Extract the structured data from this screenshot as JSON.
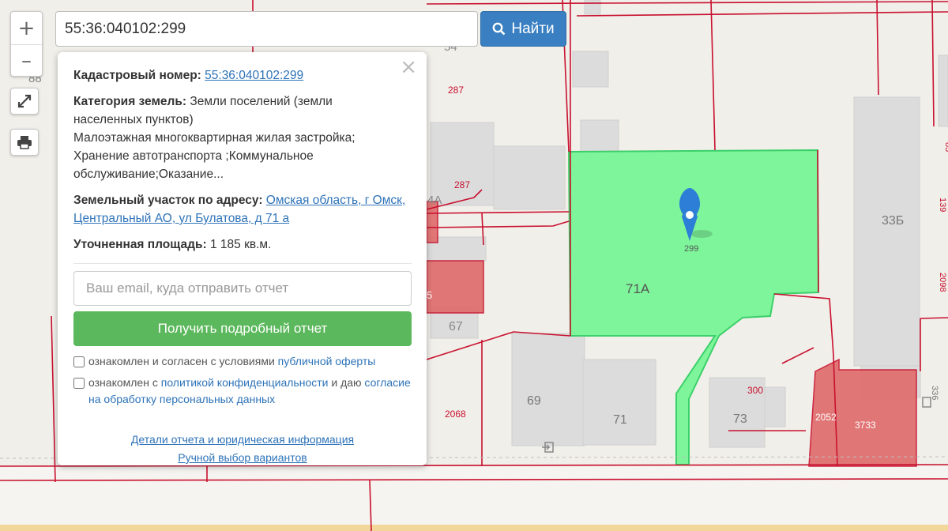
{
  "search": {
    "value": "55:36:040102:299",
    "button_label": "Найти"
  },
  "map_controls": {
    "zoom_in": "+",
    "zoom_out": "–"
  },
  "popup": {
    "close": "×",
    "cadastral_label": "Кадастровый номер:",
    "cadastral_value": "55:36:040102:299",
    "category_label": "Категория земель:",
    "category_value": "Земли поселений (земли населенных пунктов)",
    "usage_lines": [
      "Малоэтажная многоквартирная жилая застройка;",
      "Хранение автотранспорта ;Коммунальное",
      "обслуживание;Оказание..."
    ],
    "address_label": "Земельный участок по адресу:",
    "address_value": "Омская область, г Омск, Центральный АО, ул Булатова, д 71 а",
    "area_label": "Уточненная площадь:",
    "area_value": "1 185 кв.м.",
    "email_placeholder": "Ваш email, куда отправить отчет",
    "report_button": "Получить подробный отчет",
    "consent1_text": "ознакомлен и согласен с условиями",
    "consent1_link": "публичной оферты",
    "consent2_text": "ознакомлен с",
    "consent2_link": "политикой конфиденциальности",
    "consent2_text2": "и даю",
    "consent2_link2": "согласие на обработку персональных данных",
    "details_link": "Детали отчета и юридическая информация",
    "manual_link": "Ручной выбор вариантов"
  },
  "map_labels": {
    "parcel_main": "71А",
    "marker_number": "299",
    "n_88": "88",
    "n_54": "54",
    "n_287a": "287",
    "n_287b": "287",
    "n_4a": "4А",
    "n_5": "5",
    "n_67": "67",
    "n_69": "69",
    "n_71": "71",
    "n_73": "73",
    "n_300": "300",
    "n_2068": "2068",
    "n_2052": "2052",
    "n_3733": "3733",
    "n_33b": "33Б",
    "n_83": "83",
    "n_139": "139",
    "n_2098": "2098",
    "n_336": "336"
  },
  "colors": {
    "selected_parcel": "#7ef59a",
    "red_parcel": "#e06a6a",
    "border_red": "#c8102e",
    "button_blue": "#3a7fc1",
    "button_green": "#5cb85c",
    "link": "#2e73b8"
  }
}
